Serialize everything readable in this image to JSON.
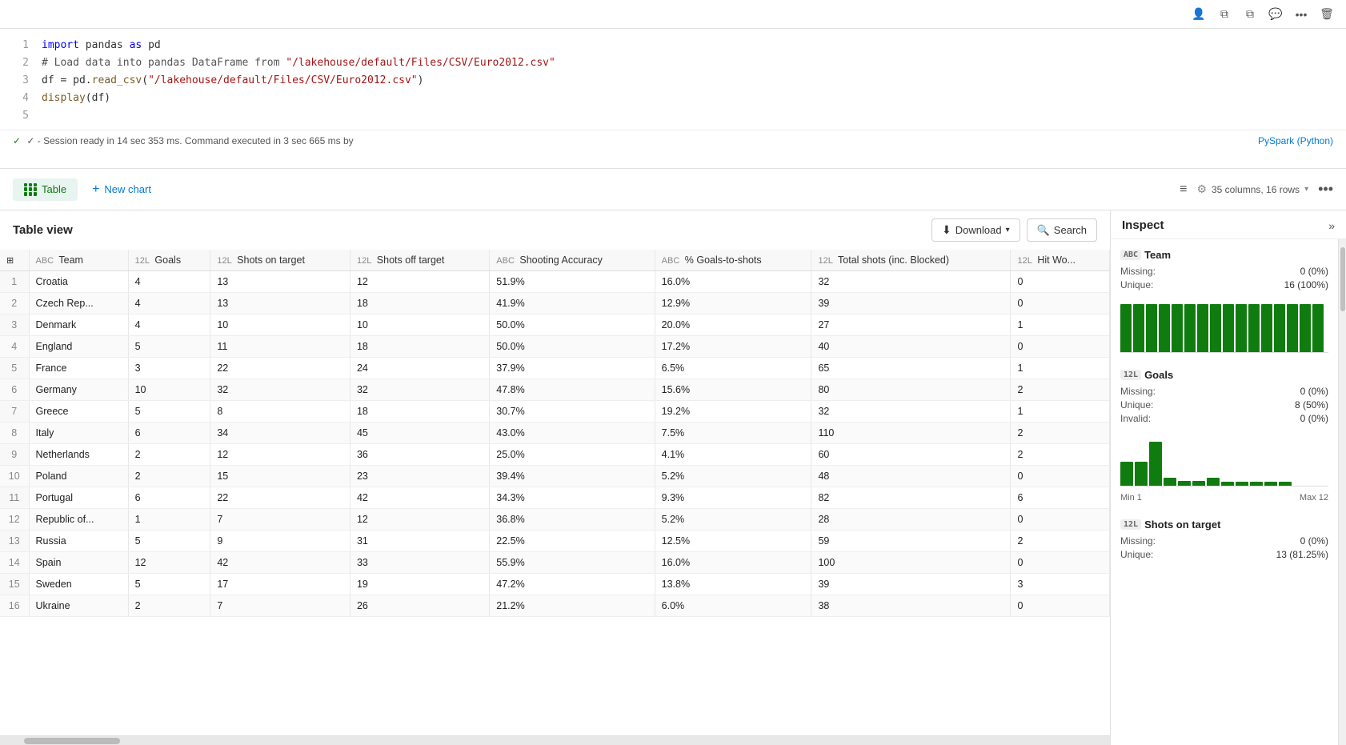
{
  "topbar": {
    "icons": [
      "user-icon",
      "monitor-icon",
      "copy-icon",
      "comment-icon",
      "more-icon",
      "delete-icon"
    ]
  },
  "code": {
    "lines": [
      {
        "num": 1,
        "text": "import pandas as pd"
      },
      {
        "num": 2,
        "text": "# Load data into pandas DataFrame from \"/lakehouse/default/Files/CSV/Euro2012.csv\""
      },
      {
        "num": 3,
        "text": "df = pd.read_csv(\"/lakehouse/default/Files/CSV/Euro2012.csv\")"
      },
      {
        "num": 4,
        "text": "display(df)"
      },
      {
        "num": 5,
        "text": ""
      }
    ],
    "status": "✓  - Session ready in 14 sec 353 ms. Command executed in 3 sec 665 ms by",
    "runtime": "PySpark (Python)"
  },
  "view_toolbar": {
    "table_label": "Table",
    "new_chart_label": "New chart",
    "columns_info": "35 columns, 16 rows",
    "filter_icon_label": "filter",
    "settings_icon_label": "settings",
    "more_icon_label": "more options"
  },
  "table_view": {
    "title": "Table view",
    "download_label": "Download",
    "search_label": "Search",
    "search_placeholder": "Search",
    "columns": [
      {
        "type": "ABC",
        "name": "Team"
      },
      {
        "type": "12L",
        "name": "Goals"
      },
      {
        "type": "12L",
        "name": "Shots on target"
      },
      {
        "type": "12L",
        "name": "Shots off target"
      },
      {
        "type": "ABC",
        "name": "Shooting Accuracy"
      },
      {
        "type": "ABC",
        "name": "% Goals-to-shots"
      },
      {
        "type": "12L",
        "name": "Total shots (inc. Blocked)"
      },
      {
        "type": "12L",
        "name": "Hit Wo..."
      }
    ],
    "rows": [
      [
        1,
        "Croatia",
        4,
        13,
        12,
        "51.9%",
        "16.0%",
        32,
        0
      ],
      [
        2,
        "Czech Rep...",
        4,
        13,
        18,
        "41.9%",
        "12.9%",
        39,
        0
      ],
      [
        3,
        "Denmark",
        4,
        10,
        10,
        "50.0%",
        "20.0%",
        27,
        1
      ],
      [
        4,
        "England",
        5,
        11,
        18,
        "50.0%",
        "17.2%",
        40,
        0
      ],
      [
        5,
        "France",
        3,
        22,
        24,
        "37.9%",
        "6.5%",
        65,
        1
      ],
      [
        6,
        "Germany",
        10,
        32,
        32,
        "47.8%",
        "15.6%",
        80,
        2
      ],
      [
        7,
        "Greece",
        5,
        8,
        18,
        "30.7%",
        "19.2%",
        32,
        1
      ],
      [
        8,
        "Italy",
        6,
        34,
        45,
        "43.0%",
        "7.5%",
        110,
        2
      ],
      [
        9,
        "Netherlands",
        2,
        12,
        36,
        "25.0%",
        "4.1%",
        60,
        2
      ],
      [
        10,
        "Poland",
        2,
        15,
        23,
        "39.4%",
        "5.2%",
        48,
        0
      ],
      [
        11,
        "Portugal",
        6,
        22,
        42,
        "34.3%",
        "9.3%",
        82,
        6
      ],
      [
        12,
        "Republic of...",
        1,
        7,
        12,
        "36.8%",
        "5.2%",
        28,
        0
      ],
      [
        13,
        "Russia",
        5,
        9,
        31,
        "22.5%",
        "12.5%",
        59,
        2
      ],
      [
        14,
        "Spain",
        12,
        42,
        33,
        "55.9%",
        "16.0%",
        100,
        0
      ],
      [
        15,
        "Sweden",
        5,
        17,
        19,
        "47.2%",
        "13.8%",
        39,
        3
      ],
      [
        16,
        "Ukraine",
        2,
        7,
        26,
        "21.2%",
        "6.0%",
        38,
        0
      ]
    ]
  },
  "inspect": {
    "title": "Inspect",
    "sections": [
      {
        "type": "ABC",
        "name": "Team",
        "stats": [
          {
            "label": "Missing:",
            "value": "0 (0%)"
          },
          {
            "label": "Unique:",
            "value": "16 (100%)"
          }
        ],
        "chart_bars": [
          6,
          6,
          6,
          6,
          6,
          6,
          6,
          6,
          6,
          6,
          6,
          6,
          6,
          6,
          6,
          6
        ],
        "has_minmax": false
      },
      {
        "type": "12L",
        "name": "Goals",
        "stats": [
          {
            "label": "Missing:",
            "value": "0 (0%)"
          },
          {
            "label": "Unique:",
            "value": "8 (50%)"
          },
          {
            "label": "Invalid:",
            "value": "0 (0%)"
          }
        ],
        "chart_bars": [
          30,
          30,
          55,
          10,
          5,
          5,
          10,
          5,
          5,
          5,
          5,
          5,
          5,
          5,
          5,
          5
        ],
        "has_minmax": true,
        "min": "Min 1",
        "max": "Max 12"
      },
      {
        "type": "12L",
        "name": "Shots on target",
        "stats": [
          {
            "label": "Missing:",
            "value": "0 (0%)"
          },
          {
            "label": "Unique:",
            "value": "13 (81.25%)"
          }
        ],
        "chart_bars": [],
        "has_minmax": false
      }
    ]
  }
}
